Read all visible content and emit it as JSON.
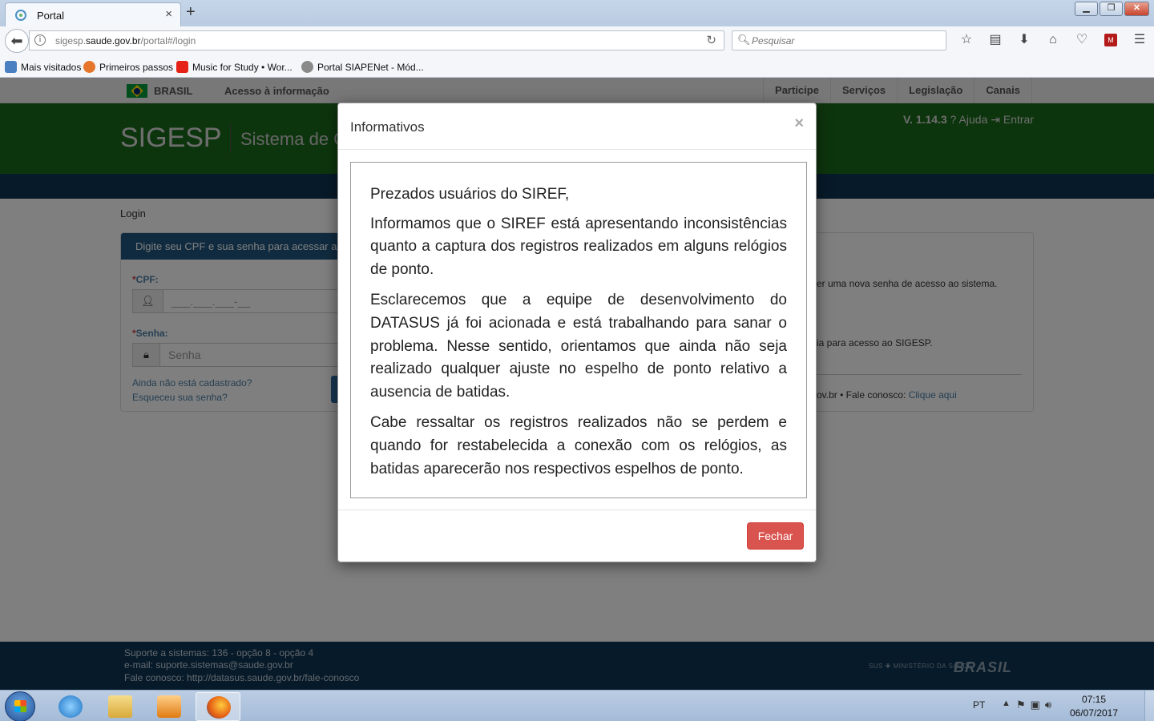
{
  "browser": {
    "tab_title": "Portal",
    "tab_close": "×",
    "new_tab": "+",
    "url_prefix": "sigesp.",
    "url_domain": "saude.gov.br",
    "url_path": "/portal#/login",
    "search_placeholder": "Pesquisar",
    "bookmarks": [
      {
        "label": "Mais visitados",
        "color": "#4a7fc1"
      },
      {
        "label": "Primeiros passos",
        "color": "#e6762b"
      },
      {
        "label": "Music for Study • Wor...",
        "color": "#e62117"
      },
      {
        "label": "Portal SIAPENet - Mód...",
        "color": "#8a8a8a"
      }
    ]
  },
  "gov_bar": {
    "brasil": "BRASIL",
    "acesso": "Acesso à informação",
    "links": [
      "Participe",
      "Serviços",
      "Legislação",
      "Canais"
    ]
  },
  "header": {
    "brand": "SIGESP",
    "subtitle": "Sistema de G",
    "version": "V. 1.14.3",
    "help": "? Ajuda",
    "enter": "Entrar"
  },
  "page": {
    "breadcrumb": "Login",
    "login_panel_header": "Digite seu CPF e sua senha para acessar a área",
    "cpf_label": "CPF:",
    "cpf_mask": "___.___.___-__",
    "senha_label": "Senha:",
    "senha_placeholder": "Senha",
    "not_registered": "Ainda não está cadastrado?",
    "forgot_password": "Esqueceu sua senha?",
    "right_text1": "er uma nova senha de acesso ao sistema.",
    "right_text2": "ia para acesso ao SIGESP.",
    "right_text3": "ov.br • Fale conosco:",
    "right_link": "Clique aqui"
  },
  "footer": {
    "line1": "Suporte a sistemas: 136 - opção 8 - opção 4",
    "line2": "e-mail: suporte.sistemas@saude.gov.br",
    "line3": "Fale conosco: http://datasus.saude.gov.br/fale-conosco",
    "logo_ministerio": "SUS ✚ MINISTÉRIO DA SAÚDE",
    "logo_brasil": "BRASIL"
  },
  "modal": {
    "title": "Informativos",
    "close": "×",
    "paragraphs": [
      "Prezados usuários do SIREF,",
      "Informamos que o SIREF está apresentando inconsistências quanto a captura dos registros realizados em alguns relógios de ponto.",
      "Esclarecemos que a equipe de desenvolvimento do DATASUS já foi acionada e está trabalhando para sanar o problema. Nesse sentido, orientamos que ainda não seja realizado qualquer ajuste no espelho de ponto relativo a ausencia de batidas.",
      "Cabe ressaltar os registros realizados não se perdem e quando for restabelecida a conexão com os relógios, as batidas aparecerão nos respectivos espelhos de ponto."
    ],
    "button": "Fechar"
  },
  "taskbar": {
    "lang": "PT",
    "time": "07:15",
    "date": "06/07/2017"
  }
}
